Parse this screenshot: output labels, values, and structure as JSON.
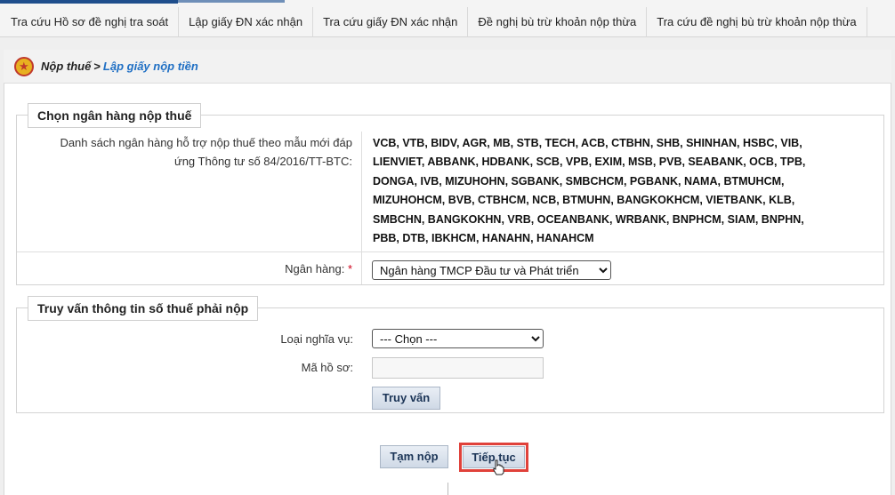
{
  "tabs": [
    {
      "label": "Tra cứu Hồ sơ đề nghị tra soát"
    },
    {
      "label": "Lập giấy ĐN xác nhận"
    },
    {
      "label": "Tra cứu giấy ĐN xác nhận"
    },
    {
      "label": "Đề nghị bù trừ khoản nộp thừa"
    },
    {
      "label": "Tra cứu đề nghị bù trừ khoản nộp thừa"
    }
  ],
  "breadcrumb": {
    "parent": "Nộp thuế",
    "separator": ">",
    "current": "Lập giấy nộp tiền"
  },
  "bank_section": {
    "legend": "Chọn ngân hàng nộp thuế",
    "list_label_line1": "Danh sách ngân hàng hỗ trợ nộp thuế theo mẫu mới đáp",
    "list_label_line2": "ứng Thông tư số 84/2016/TT-BTC:",
    "bank_lines": [
      "VCB, VTB, BIDV, AGR, MB, STB, TECH, ACB, CTBHN, SHB, SHINHAN, HSBC, VIB,",
      "LIENVIET, ABBANK, HDBANK, SCB, VPB, EXIM, MSB, PVB, SEABANK, OCB, TPB,",
      "DONGA, IVB, MIZUHOHN, SGBANK, SMBCHCM, PGBANK, NAMA, BTMUHCM,",
      "MIZUHOHCM, BVB, CTBHCM, NCB, BTMUHN, BANGKOKHCM, VIETBANK, KLB,",
      "SMBCHN, BANGKOKHN, VRB, OCEANBANK, WRBANK, BNPHCM, SIAM, BNPHN,",
      "PBB, DTB, IBKHCM, HANAHN, HANAHCM"
    ],
    "bank_label": "Ngân hàng:",
    "required_mark": "*",
    "bank_selected": "Ngân hàng TMCP Đầu tư và Phát triển"
  },
  "query_section": {
    "legend": "Truy vấn thông tin số thuế phải nộp",
    "obligation_label": "Loại nghĩa vụ:",
    "obligation_selected": "--- Chọn ---",
    "file_label": "Mã hồ sơ:",
    "file_value": "",
    "query_button": "Truy vấn"
  },
  "actions": {
    "temp_submit": "Tạm nộp",
    "continue": "Tiếp tục"
  },
  "colors": {
    "link": "#1f6fc4",
    "highlight": "#e0413a",
    "required": "#d0021b"
  }
}
